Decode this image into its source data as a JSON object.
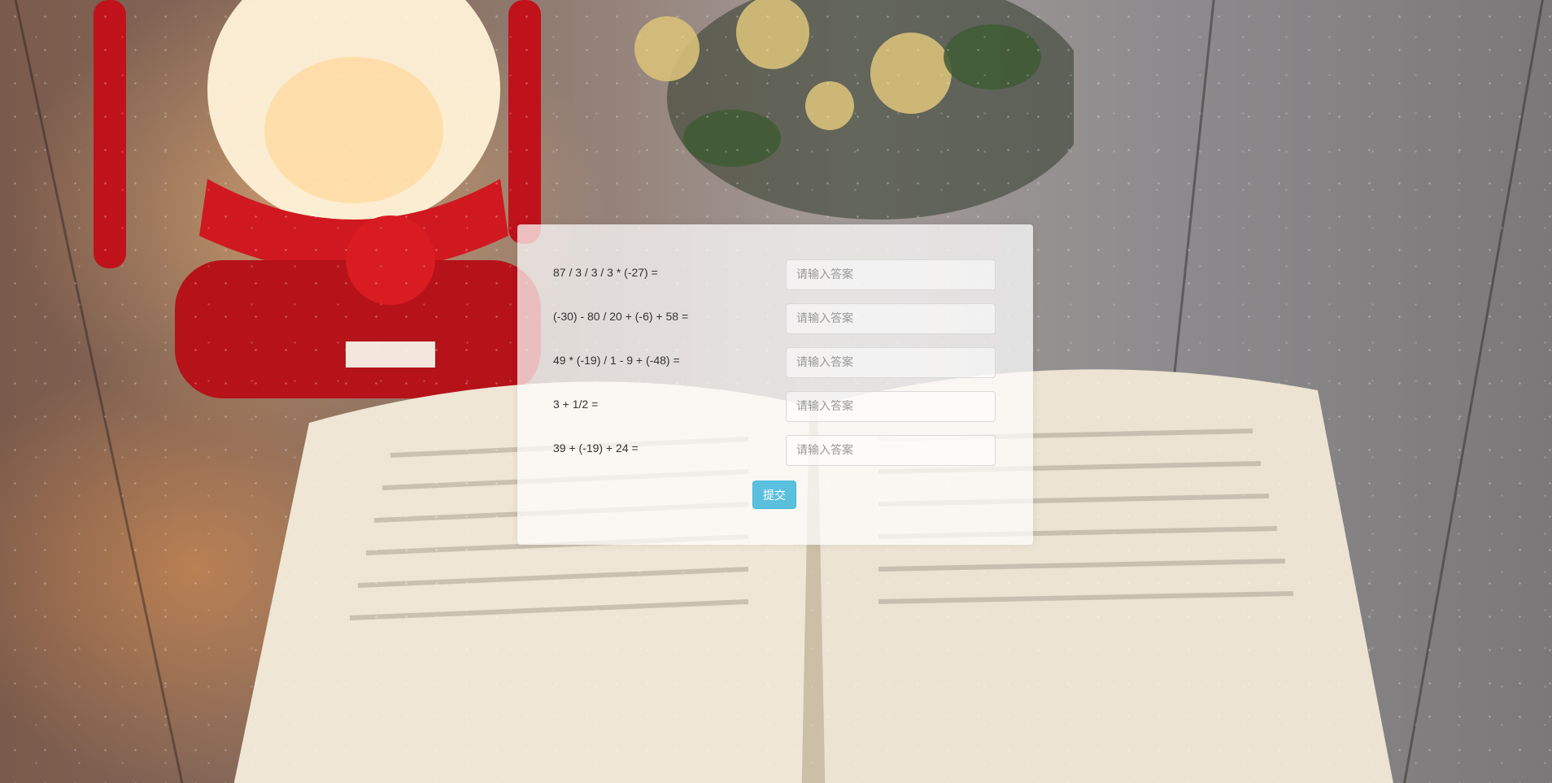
{
  "form": {
    "questions": [
      {
        "expression": "87 / 3 / 3 / 3 * (-27) =",
        "placeholder": "请输入答案",
        "value": ""
      },
      {
        "expression": "(-30) - 80 / 20 + (-6) + 58 =",
        "placeholder": "请输入答案",
        "value": ""
      },
      {
        "expression": "49 * (-19) / 1 - 9 + (-48) =",
        "placeholder": "请输入答案",
        "value": ""
      },
      {
        "expression": "3 + 1/2 =",
        "placeholder": "请输入答案",
        "value": ""
      },
      {
        "expression": "39 + (-19) + 24 =",
        "placeholder": "请输入答案",
        "value": ""
      }
    ],
    "submit_label": "提交"
  },
  "colors": {
    "submit_button": "#5bc0de",
    "card_background": "rgba(255,255,255,0.72)"
  }
}
